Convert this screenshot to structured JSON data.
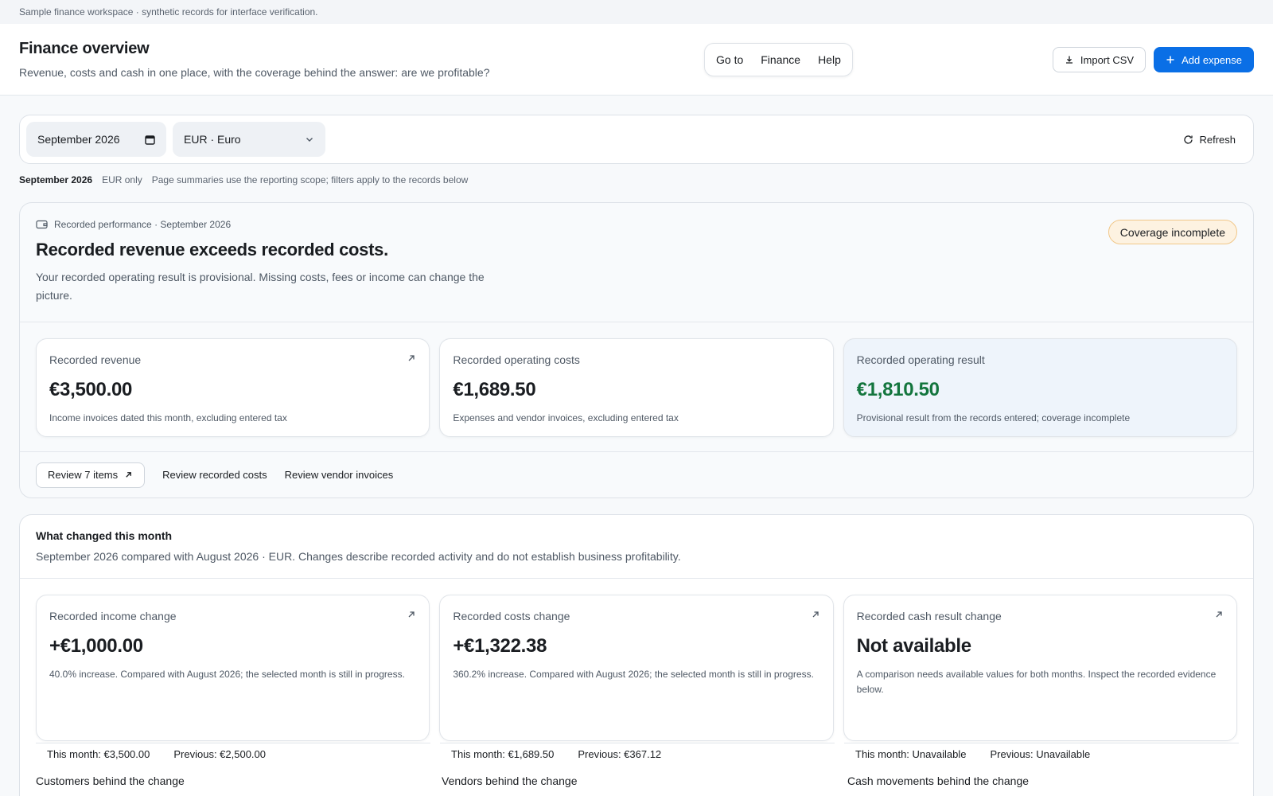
{
  "banner": "Sample finance workspace · synthetic records for interface verification.",
  "header": {
    "title": "Finance overview",
    "subtitle": "Revenue, costs and cash in one place, with the coverage behind the answer: are we profitable?",
    "nav": [
      "Go to",
      "Finance",
      "Help"
    ],
    "import_label": "Import CSV",
    "add_label": "Add expense"
  },
  "filters": {
    "month": "September 2026",
    "currency": "EUR · Euro",
    "refresh_label": "Refresh"
  },
  "scope": {
    "period": "September 2026",
    "currency_note": "EUR only",
    "note": "Page summaries use the reporting scope; filters apply to the records below"
  },
  "performance": {
    "eyebrow": "Recorded performance · September 2026",
    "title": "Recorded revenue exceeds recorded costs.",
    "description": "Your recorded operating result is provisional. Missing costs, fees or income can change the picture.",
    "badge": "Coverage incomplete",
    "cards": [
      {
        "label": "Recorded revenue",
        "value": "€3,500.00",
        "note": "Income invoices dated this month, excluding entered tax"
      },
      {
        "label": "Recorded operating costs",
        "value": "€1,689.50",
        "note": "Expenses and vendor invoices, excluding entered tax"
      },
      {
        "label": "Recorded operating result",
        "value": "€1,810.50",
        "note": "Provisional result from the records entered; coverage incomplete"
      }
    ],
    "actions": {
      "review": "Review 7 items",
      "costs": "Review recorded costs",
      "vendors": "Review vendor invoices"
    }
  },
  "changes": {
    "title": "What changed this month",
    "subtitle": "September 2026 compared with August 2026 · EUR. Changes describe recorded activity and do not establish business profitability.",
    "cards": [
      {
        "label": "Recorded income change",
        "value": "+€1,000.00",
        "note": "40.0% increase. Compared with August 2026; the selected month is still in progress.",
        "this_month": "This month: €3,500.00",
        "previous": "Previous: €2,500.00",
        "behind": "Customers behind the change"
      },
      {
        "label": "Recorded costs change",
        "value": "+€1,322.38",
        "note": "360.2% increase. Compared with August 2026; the selected month is still in progress.",
        "this_month": "This month: €1,689.50",
        "previous": "Previous: €367.12",
        "behind": "Vendors behind the change"
      },
      {
        "label": "Recorded cash result change",
        "value": "Not available",
        "note": "A comparison needs available values for both months. Inspect the recorded evidence below.",
        "this_month": "This month: Unavailable",
        "previous": "Previous: Unavailable",
        "behind": "Cash movements behind the change"
      }
    ]
  },
  "colors": {
    "primary": "#0a6fe6",
    "positive": "#13753d",
    "warning_bg": "#fdf2e1",
    "warning_border": "#f1c789"
  }
}
